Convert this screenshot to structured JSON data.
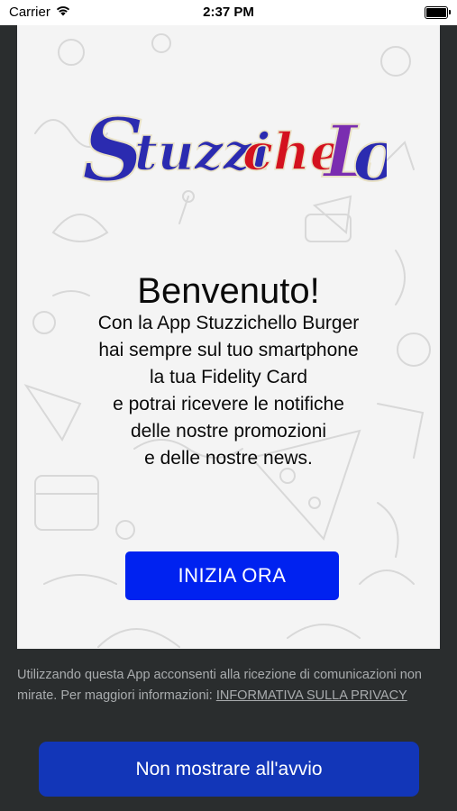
{
  "status_bar": {
    "carrier": "Carrier",
    "time": "2:37 PM",
    "icons": [
      "wifi-icon",
      "battery-icon"
    ]
  },
  "logo": {
    "alt": "Stuzzichello",
    "colors": [
      "#2b2bb0",
      "#d4121e",
      "#e9e2c6"
    ]
  },
  "welcome": {
    "title": "Benvenuto!",
    "lines": [
      "Con la App Stuzzichello Burger",
      "hai sempre sul tuo smartphone",
      "la tua Fidelity Card",
      "e potrai ricevere le notifiche",
      "delle nostre promozioni",
      "e delle nostre news."
    ]
  },
  "start_button": {
    "label": "INIZIA ORA",
    "color": "#0022f0"
  },
  "consent": {
    "text": "Utilizzando questa App acconsenti alla ricezione di comunicazioni non mirate. Per maggiori informazioni: ",
    "link": "INFORMATIVA SULLA PRIVACY"
  },
  "dont_show_button": {
    "label": "Non mostrare all'avvio",
    "color": "#1236b8"
  },
  "colors": {
    "background": "#2a2d2e",
    "card": "#f4f4f4"
  }
}
